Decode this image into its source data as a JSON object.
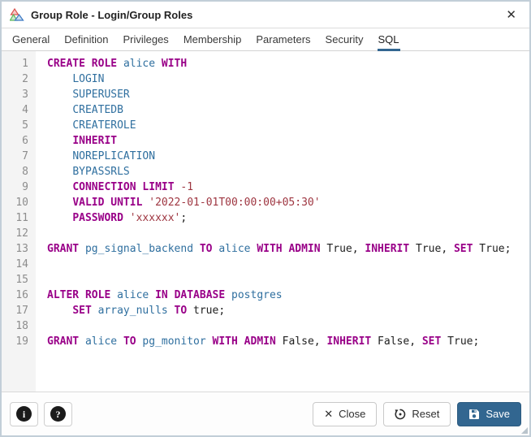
{
  "window": {
    "title": "Group Role - Login/Group Roles",
    "close_glyph": "✕"
  },
  "tabs": {
    "items": [
      {
        "label": "General",
        "active": false
      },
      {
        "label": "Definition",
        "active": false
      },
      {
        "label": "Privileges",
        "active": false
      },
      {
        "label": "Membership",
        "active": false
      },
      {
        "label": "Parameters",
        "active": false
      },
      {
        "label": "Security",
        "active": false
      },
      {
        "label": "SQL",
        "active": true
      }
    ]
  },
  "editor": {
    "language": "sql",
    "lines": [
      [
        [
          "k",
          "CREATE"
        ],
        [
          "p",
          " "
        ],
        [
          "k",
          "ROLE"
        ],
        [
          "p",
          " "
        ],
        [
          "v",
          "alice"
        ],
        [
          "p",
          " "
        ],
        [
          "k",
          "WITH"
        ]
      ],
      [
        [
          "p",
          "    "
        ],
        [
          "v",
          "LOGIN"
        ]
      ],
      [
        [
          "p",
          "    "
        ],
        [
          "v",
          "SUPERUSER"
        ]
      ],
      [
        [
          "p",
          "    "
        ],
        [
          "v",
          "CREATEDB"
        ]
      ],
      [
        [
          "p",
          "    "
        ],
        [
          "v",
          "CREATEROLE"
        ]
      ],
      [
        [
          "p",
          "    "
        ],
        [
          "k",
          "INHERIT"
        ]
      ],
      [
        [
          "p",
          "    "
        ],
        [
          "v",
          "NOREPLICATION"
        ]
      ],
      [
        [
          "p",
          "    "
        ],
        [
          "v",
          "BYPASSRLS"
        ]
      ],
      [
        [
          "p",
          "    "
        ],
        [
          "k",
          "CONNECTION"
        ],
        [
          "p",
          " "
        ],
        [
          "k",
          "LIMIT"
        ],
        [
          "p",
          " "
        ],
        [
          "n",
          "-1"
        ]
      ],
      [
        [
          "p",
          "    "
        ],
        [
          "k",
          "VALID"
        ],
        [
          "p",
          " "
        ],
        [
          "k",
          "UNTIL"
        ],
        [
          "p",
          " "
        ],
        [
          "s",
          "'2022-01-01T00:00:00+05:30'"
        ]
      ],
      [
        [
          "p",
          "    "
        ],
        [
          "k",
          "PASSWORD"
        ],
        [
          "p",
          " "
        ],
        [
          "s",
          "'xxxxxx'"
        ],
        [
          "p",
          ";"
        ]
      ],
      [],
      [
        [
          "k",
          "GRANT"
        ],
        [
          "p",
          " "
        ],
        [
          "v",
          "pg_signal_backend"
        ],
        [
          "p",
          " "
        ],
        [
          "k",
          "TO"
        ],
        [
          "p",
          " "
        ],
        [
          "v",
          "alice"
        ],
        [
          "p",
          " "
        ],
        [
          "k",
          "WITH"
        ],
        [
          "p",
          " "
        ],
        [
          "k",
          "ADMIN"
        ],
        [
          "p",
          " True, "
        ],
        [
          "k",
          "INHERIT"
        ],
        [
          "p",
          " True, "
        ],
        [
          "k",
          "SET"
        ],
        [
          "p",
          " True;"
        ]
      ],
      [],
      [],
      [
        [
          "k",
          "ALTER"
        ],
        [
          "p",
          " "
        ],
        [
          "k",
          "ROLE"
        ],
        [
          "p",
          " "
        ],
        [
          "v",
          "alice"
        ],
        [
          "p",
          " "
        ],
        [
          "k",
          "IN"
        ],
        [
          "p",
          " "
        ],
        [
          "k",
          "DATABASE"
        ],
        [
          "p",
          " "
        ],
        [
          "v",
          "postgres"
        ]
      ],
      [
        [
          "p",
          "    "
        ],
        [
          "k",
          "SET"
        ],
        [
          "p",
          " "
        ],
        [
          "v",
          "array_nulls"
        ],
        [
          "p",
          " "
        ],
        [
          "k",
          "TO"
        ],
        [
          "p",
          " true;"
        ]
      ],
      [],
      [
        [
          "k",
          "GRANT"
        ],
        [
          "p",
          " "
        ],
        [
          "v",
          "alice"
        ],
        [
          "p",
          " "
        ],
        [
          "k",
          "TO"
        ],
        [
          "p",
          " "
        ],
        [
          "v",
          "pg_monitor"
        ],
        [
          "p",
          " "
        ],
        [
          "k",
          "WITH"
        ],
        [
          "p",
          " "
        ],
        [
          "k",
          "ADMIN"
        ],
        [
          "p",
          " False, "
        ],
        [
          "k",
          "INHERIT"
        ],
        [
          "p",
          " False, "
        ],
        [
          "k",
          "SET"
        ],
        [
          "p",
          " True;"
        ]
      ]
    ]
  },
  "footer": {
    "info_glyph": "i",
    "help_glyph": "?",
    "close": {
      "label": "Close",
      "glyph": "✕"
    },
    "reset": {
      "label": "Reset"
    },
    "save": {
      "label": "Save"
    }
  },
  "colors": {
    "accent": "#326690",
    "keyword": "#990088",
    "identifier": "#2f6f9f",
    "literal": "#9e3540"
  }
}
